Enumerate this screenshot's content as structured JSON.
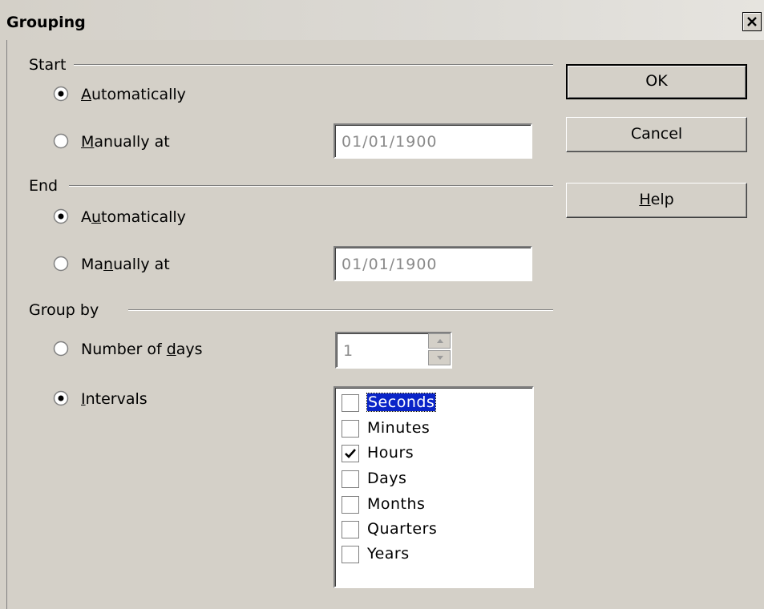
{
  "window": {
    "title": "Grouping",
    "close_label": "×"
  },
  "start": {
    "section_label": "Start",
    "auto_label_u": "A",
    "auto_label_rest": "utomatically",
    "manual_label_u": "M",
    "manual_label_rest": "anually at",
    "selected": "automatically",
    "date_value": "01/01/1900"
  },
  "end": {
    "section_label": "End",
    "auto_label_pre": "A",
    "auto_label_u": "u",
    "auto_label_rest": "tomatically",
    "manual_label_pre": "Ma",
    "manual_label_u": "n",
    "manual_label_rest": "ually at",
    "selected": "automatically",
    "date_value": "01/01/1900"
  },
  "group_by": {
    "section_label": "Group by",
    "days_label_pre": "Number of ",
    "days_label_u": "d",
    "days_label_rest": "ays",
    "intervals_label_u": "I",
    "intervals_label_rest": "ntervals",
    "selected": "intervals",
    "days_value": "1",
    "intervals": [
      {
        "label": "Seconds",
        "checked": false,
        "highlighted": true
      },
      {
        "label": "Minutes",
        "checked": false,
        "highlighted": false
      },
      {
        "label": "Hours",
        "checked": true,
        "highlighted": false
      },
      {
        "label": "Days",
        "checked": false,
        "highlighted": false
      },
      {
        "label": "Months",
        "checked": false,
        "highlighted": false
      },
      {
        "label": "Quarters",
        "checked": false,
        "highlighted": false
      },
      {
        "label": "Years",
        "checked": false,
        "highlighted": false
      }
    ]
  },
  "buttons": {
    "ok_label": "OK",
    "cancel_label": "Cancel",
    "help_label_u": "H",
    "help_label_rest": "elp"
  },
  "colors": {
    "dialog_bg": "#d4d0c8",
    "selection": "#0a24c8"
  }
}
